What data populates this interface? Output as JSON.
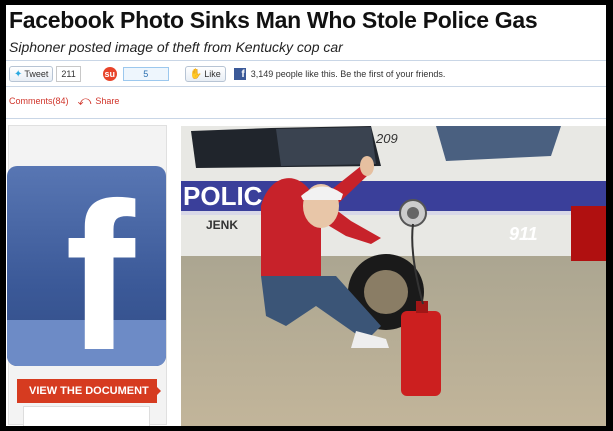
{
  "article": {
    "headline": "Facebook Photo Sinks Man Who Stole Police Gas",
    "subhead": "Siphoner posted image of theft from Kentucky cop car"
  },
  "share_bar": {
    "tweet_label": "Tweet",
    "tweet_count": "211",
    "stumble_count": "5",
    "like_label": "Like",
    "like_text": "3,149 people like this. Be the first of your friends."
  },
  "comments": {
    "comments_label": "Comments(84)",
    "share_label": "Share"
  },
  "sidebar": {
    "logo_letter": "f",
    "banner_label": "VIEW THE DOCUMENT"
  },
  "photo": {
    "car_number": "209",
    "door_text": "POLIC",
    "fender_text": "911",
    "shirt_text": "JENK"
  },
  "colors": {
    "facebook_blue": "#3b5998",
    "accent_red": "#d63b20",
    "police_stripe": "#3a3f9a"
  }
}
